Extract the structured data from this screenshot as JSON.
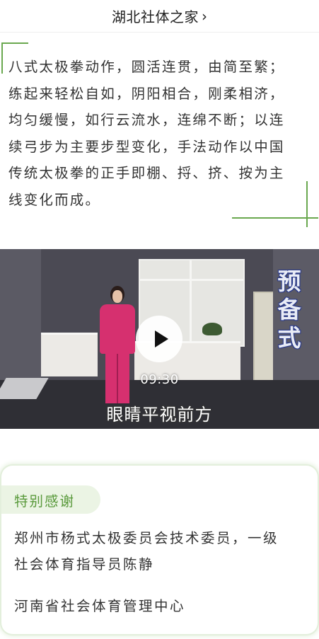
{
  "header": {
    "title": "湖北社体之家",
    "chevron_glyph": "›"
  },
  "intro": {
    "lines": [
      "八式太极拳动作，圆活连贯，由简至繁；",
      "练起来轻松自如，阴阳相合，刚柔相济，",
      "均匀缓慢，如行云流水，连绵不断；以连",
      "续弓步为主要步型变化，手法动作以中国",
      "传统太极拳的正手即棚、捋、挤、按为主",
      "线变化而成。"
    ]
  },
  "video": {
    "duration": "09:30",
    "subtitle": "眼睛平视前方",
    "sign_chars": [
      "预",
      "备",
      "式"
    ],
    "play_icon": "play-icon"
  },
  "thanks": {
    "tag": "特别感谢",
    "items": [
      [
        "郑州市杨式太极委员会技术委员，一级",
        "社会体育指导员陈静"
      ],
      [
        "河南省社会体育管理中心"
      ]
    ]
  },
  "colors": {
    "accent_green": "#6aa84f",
    "tag_text": "#5a9a3c",
    "tag_bg": "#ebf4e4",
    "text": "#333333"
  }
}
